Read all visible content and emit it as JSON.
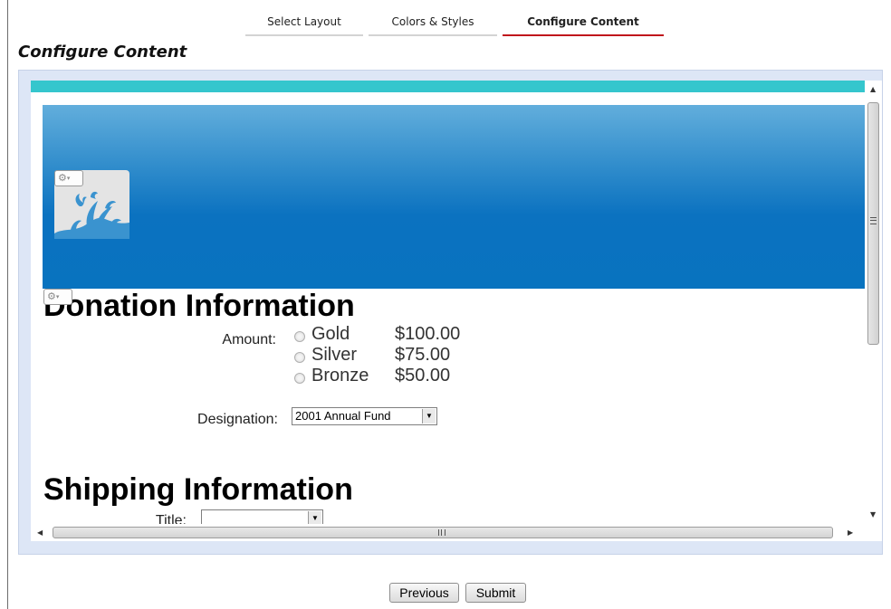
{
  "wizard": {
    "tabs": [
      {
        "label": "Select Layout",
        "active": false
      },
      {
        "label": "Colors & Styles",
        "active": false
      },
      {
        "label": "Configure Content",
        "active": true
      }
    ],
    "active_color": "#c0161c"
  },
  "page_title": "Configure Content",
  "preview": {
    "accent_bar_color": "#35c6cd",
    "banner_color": "#0873bf",
    "logo": {
      "icon": "gear-icon",
      "caret": "▾"
    },
    "section_gear": {
      "icon": "gear-icon",
      "caret": "▾"
    },
    "donation": {
      "heading": "Donation Information",
      "amount_label": "Amount:",
      "options": [
        {
          "name": "Gold",
          "price": "$100.00"
        },
        {
          "name": "Silver",
          "price": "$75.00"
        },
        {
          "name": "Bronze",
          "price": "$50.00"
        }
      ],
      "designation_label": "Designation:",
      "designation_value": "2001 Annual Fund"
    },
    "shipping": {
      "heading": "Shipping Information",
      "title_label": "Title:",
      "title_value": ""
    }
  },
  "scrollbars": {
    "up_arrow": "▲",
    "down_arrow": "▼",
    "left_arrow": "◀",
    "right_arrow": "▶",
    "dropdown_arrow": "▼"
  },
  "buttons": {
    "previous": "Previous",
    "submit": "Submit"
  }
}
